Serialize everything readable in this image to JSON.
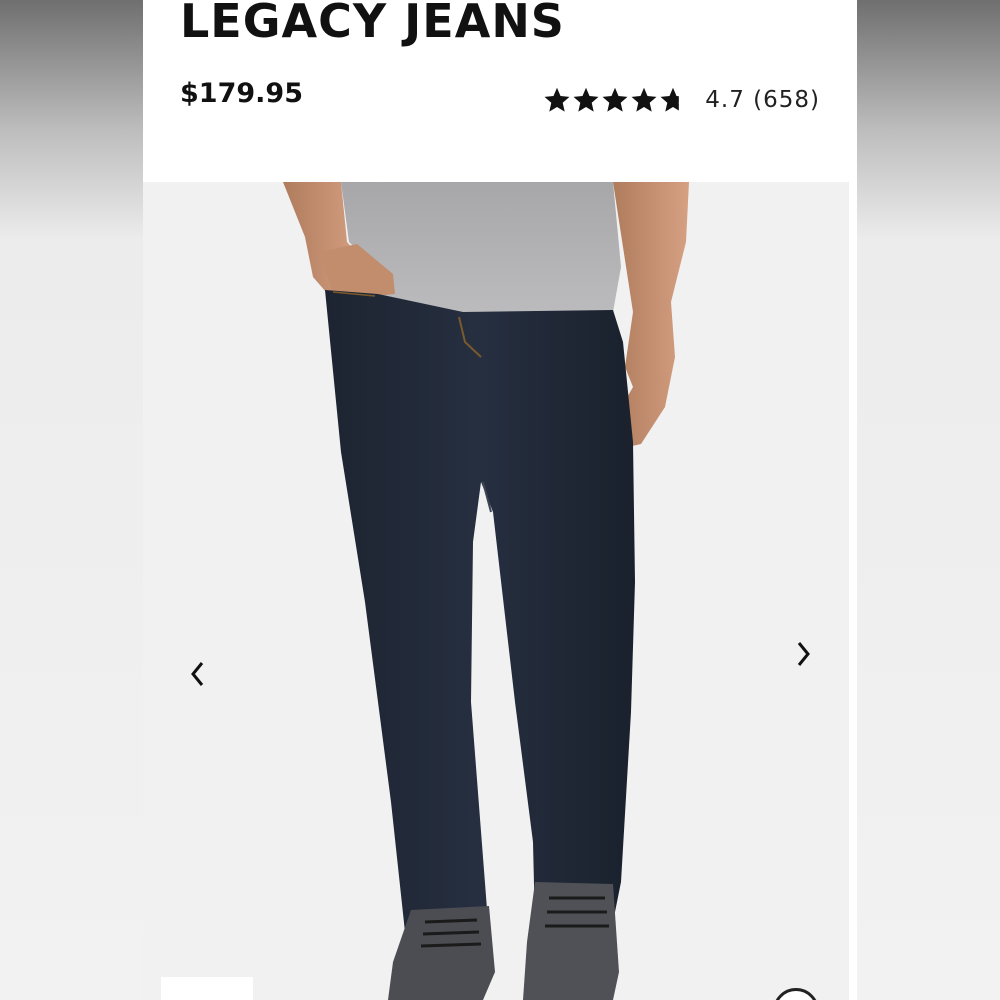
{
  "product": {
    "title": "LEGACY JEANS",
    "price": "$179.95",
    "rating_value": 4.7,
    "rating_count": "(658)",
    "rating_text": "4.7 (658)",
    "stars": {
      "filled": 4.7,
      "max": 5,
      "color": "#111111"
    }
  },
  "gallery": {
    "image": "man-wearing-dark-jeans-photo",
    "prev_icon": "chevron-left-icon",
    "next_icon": "chevron-right-icon",
    "zoom_icon": "zoom-icon"
  }
}
